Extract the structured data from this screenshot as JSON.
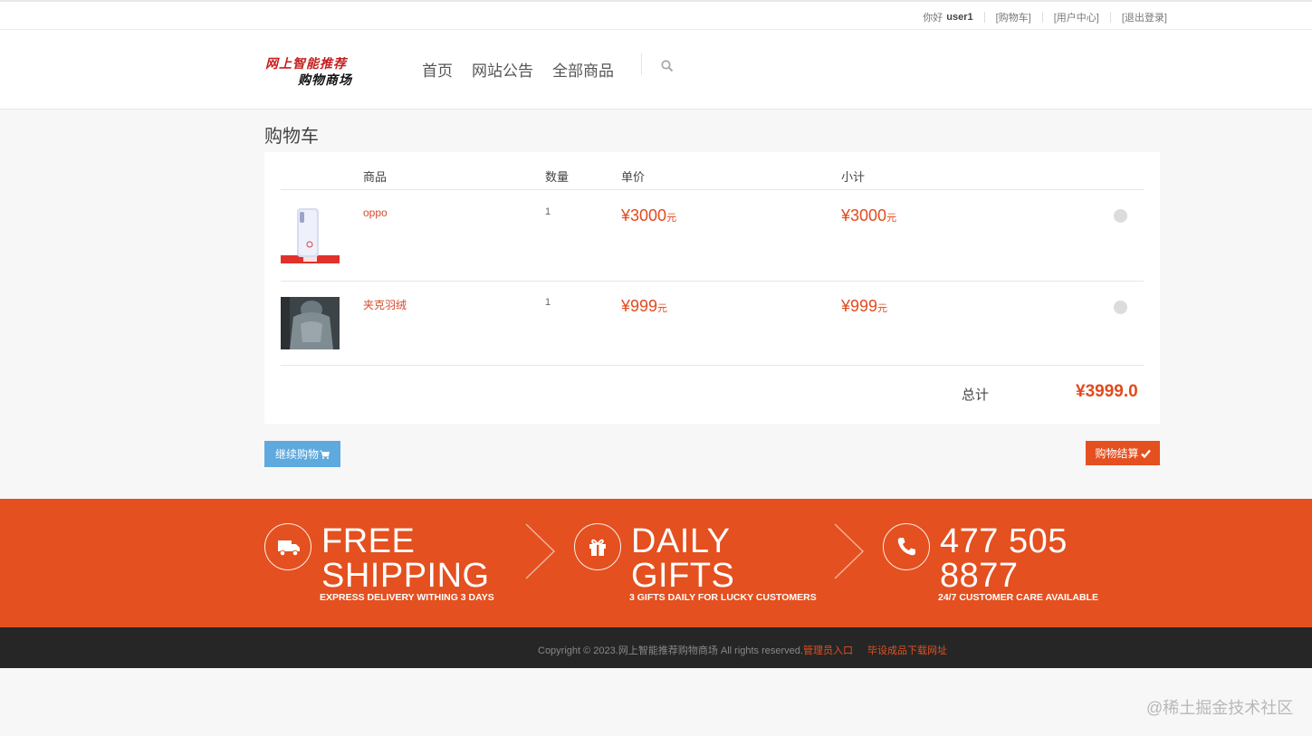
{
  "topbar": {
    "greeting": "你好",
    "username": "user1",
    "links": [
      "[购物车]",
      "[用户中心]",
      "[退出登录]"
    ]
  },
  "logo": {
    "line1": "网上智能推荐",
    "line2": "购物商场"
  },
  "nav": {
    "items": [
      "首页",
      "网站公告",
      "全部商品"
    ]
  },
  "page_title": "购物车",
  "cart": {
    "columns": {
      "product": "商品",
      "quantity": "数量",
      "unit_price": "单价",
      "subtotal": "小计"
    },
    "items": [
      {
        "name": "oppo",
        "quantity": "1",
        "price": "¥3000",
        "price_unit": "元",
        "subtotal": "¥3000",
        "subtotal_unit": "元"
      },
      {
        "name": "夹克羽绒",
        "quantity": "1",
        "price": "¥999",
        "price_unit": "元",
        "subtotal": "¥999",
        "subtotal_unit": "元"
      }
    ],
    "total_label": "总计",
    "total_value": "¥3999.0"
  },
  "buttons": {
    "continue": "继续购物",
    "checkout": "购物结算"
  },
  "promo": [
    {
      "line1": "FREE",
      "line2": "SHIPPING",
      "sub": "EXPRESS DELIVERY WITHING 3 DAYS",
      "icon": "truck-icon"
    },
    {
      "line1": "DAILY",
      "line2": "GIFTS",
      "sub": "3 GIFTS DAILY FOR LUCKY CUSTOMERS",
      "icon": "gift-icon"
    },
    {
      "line1": "477 505",
      "line2": "8877",
      "sub": "24/7 CUSTOMER CARE AVAILABLE",
      "icon": "phone-icon"
    }
  ],
  "footer": {
    "copyright": "Copyright © 2023.网上智能推荐购物商场 All rights reserved.",
    "admin_link": "管理员入口",
    "download_link": "毕设成品下载网址"
  },
  "watermark": "@稀土掘金技术社区",
  "colors": {
    "accent": "#e4501f",
    "continue_button": "#5ea9dd",
    "footer_bg": "#262626"
  }
}
